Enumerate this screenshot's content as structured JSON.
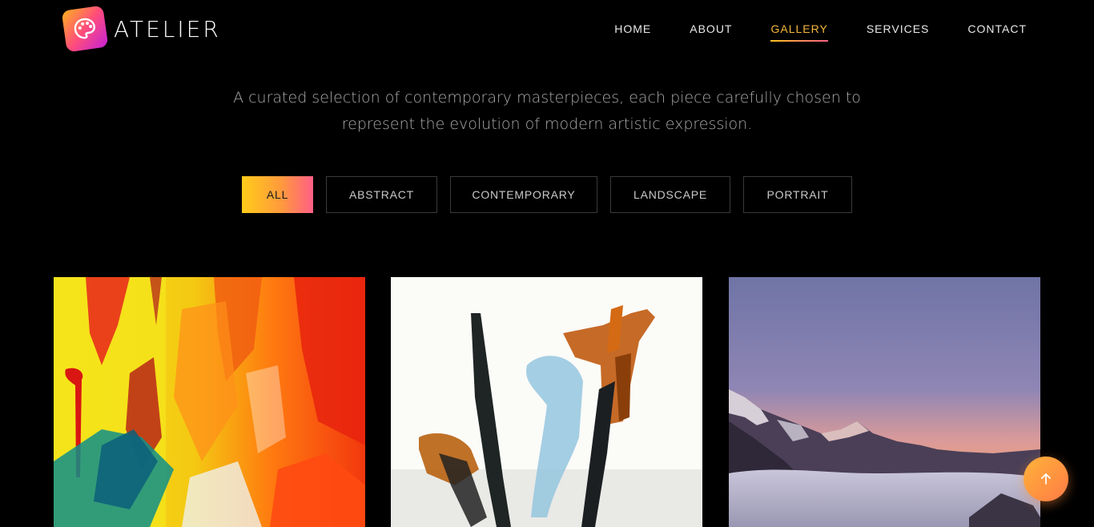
{
  "brand": {
    "name": "ATELIER",
    "icon": "palette-icon"
  },
  "nav": {
    "items": [
      {
        "label": "HOME"
      },
      {
        "label": "ABOUT"
      },
      {
        "label": "GALLERY",
        "active": true
      },
      {
        "label": "SERVICES"
      },
      {
        "label": "CONTACT"
      }
    ]
  },
  "intro": {
    "line1": "A curated selection of contemporary masterpieces, each piece carefully chosen to",
    "line2": "represent the evolution of modern artistic expression."
  },
  "filters": [
    {
      "label": "ALL",
      "active": true
    },
    {
      "label": "ABSTRACT"
    },
    {
      "label": "CONTEMPORARY"
    },
    {
      "label": "LANDSCAPE"
    },
    {
      "label": "PORTRAIT"
    }
  ],
  "scroll_top": {
    "icon": "arrow-up-icon"
  },
  "colors": {
    "accent": "#f5b63a",
    "gradient_start": "#ffcc1a",
    "gradient_end": "#ff5f86",
    "background": "#000000"
  }
}
